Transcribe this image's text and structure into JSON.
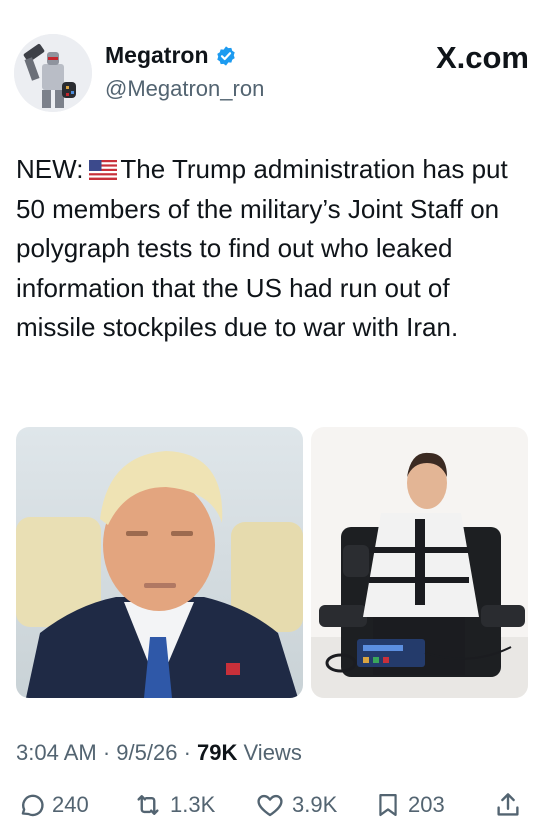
{
  "author": {
    "display_name": "Megatron",
    "handle": "@Megatron_ron",
    "verified_icon": "verified-badge-icon",
    "avatar_icon": "robot-avatar-icon"
  },
  "brand": {
    "label": "X.com"
  },
  "tweet": {
    "lead": "NEW:",
    "flag_icon": "us-flag-icon",
    "body": "The Trump administration has put 50 members of the military’s Joint Staff on polygraph tests to find out who leaked information that the US had run out of missile stockpiles due to war with Iran."
  },
  "media": {
    "images": [
      {
        "icon": "portrait-photo"
      },
      {
        "icon": "polygraph-test-photo"
      }
    ]
  },
  "meta": {
    "time": "3:04 AM",
    "separator": "·",
    "date": "9/5/26",
    "views_count": "79K",
    "views_label": "Views"
  },
  "actions": {
    "replies": "240",
    "reposts": "1.3K",
    "likes": "3.9K",
    "bookmarks": "203"
  },
  "colors": {
    "text": "#0f1419",
    "secondary": "#536471",
    "verified": "#1d9bf0"
  }
}
